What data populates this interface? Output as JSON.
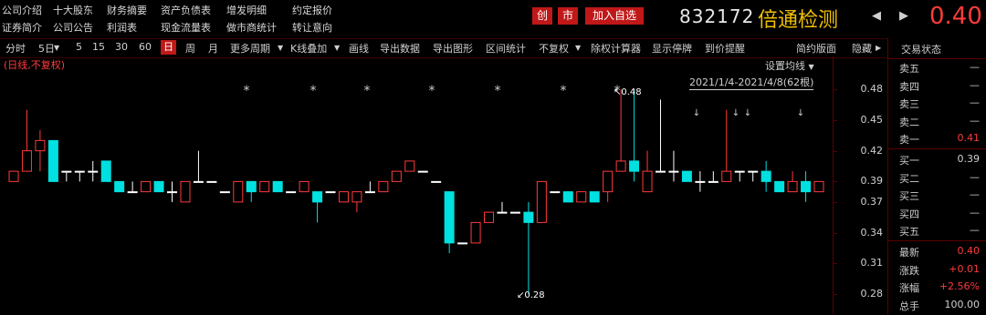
{
  "topbar": {
    "links_row1": [
      "公司介绍",
      "十大股东",
      "财务摘要",
      "资产负债表",
      "增发明细",
      "约定报价"
    ],
    "links_row2": [
      "证券简介",
      "公司公告",
      "利润表",
      "现金流量表",
      "做市商统计",
      "转让意向"
    ],
    "badge_chuang": "创",
    "badge_shi": "市",
    "add_favorite": "加入自选",
    "stock_code": "832172",
    "stock_name": "倍通检测",
    "price": "0.40",
    "prev_arrow": "◀",
    "next_arrow": "▶"
  },
  "toolbar": {
    "items": [
      "分时",
      "5日",
      "5",
      "15",
      "30",
      "60",
      "日",
      "周",
      "月",
      "更多周期",
      "K线叠加",
      "画线",
      "导出数据",
      "导出图形",
      "区间统计",
      "不复权",
      "除权计算器",
      "显示停牌",
      "到价提醒",
      "简约版面",
      "隐藏"
    ],
    "active": "日"
  },
  "chart_caption": "(日线,不复权)",
  "ma_setting": "设置均线",
  "range_label": "2021/1/4-2021/4/8(62根)",
  "high_label": "0.48",
  "low_label": "0.28",
  "star_marker": "*",
  "down_marker": "↓",
  "y_ticks": [
    "0.48",
    "0.45",
    "0.42",
    "0.39",
    "0.37",
    "0.34",
    "0.31",
    "0.28"
  ],
  "colors": {
    "up": "#ff3b3b",
    "down": "#00e0e0",
    "flat": "#ffffff",
    "accent": "#c01818",
    "name": "#f0c000"
  },
  "chart_data": {
    "type": "candlestick",
    "ylim": [
      0.265,
      0.505
    ],
    "candles": [
      {
        "o": 0.39,
        "h": 0.39,
        "l": 0.39,
        "c": 0.4
      },
      {
        "o": 0.4,
        "h": 0.46,
        "l": 0.4,
        "c": 0.42
      },
      {
        "o": 0.42,
        "h": 0.44,
        "l": 0.4,
        "c": 0.43
      },
      {
        "o": 0.43,
        "h": 0.43,
        "l": 0.39,
        "c": 0.39
      },
      {
        "o": 0.4,
        "h": 0.4,
        "l": 0.39,
        "c": 0.4
      },
      {
        "o": 0.4,
        "h": 0.4,
        "l": 0.39,
        "c": 0.4
      },
      {
        "o": 0.4,
        "h": 0.41,
        "l": 0.39,
        "c": 0.4
      },
      {
        "o": 0.41,
        "h": 0.41,
        "l": 0.39,
        "c": 0.39
      },
      {
        "o": 0.39,
        "h": 0.39,
        "l": 0.38,
        "c": 0.38
      },
      {
        "o": 0.38,
        "h": 0.39,
        "l": 0.38,
        "c": 0.38
      },
      {
        "o": 0.38,
        "h": 0.39,
        "l": 0.38,
        "c": 0.39
      },
      {
        "o": 0.39,
        "h": 0.39,
        "l": 0.38,
        "c": 0.38
      },
      {
        "o": 0.38,
        "h": 0.39,
        "l": 0.37,
        "c": 0.38
      },
      {
        "o": 0.37,
        "h": 0.39,
        "l": 0.37,
        "c": 0.39
      },
      {
        "o": 0.39,
        "h": 0.42,
        "l": 0.39,
        "c": 0.39
      },
      {
        "o": 0.39,
        "h": 0.39,
        "l": 0.39,
        "c": 0.39
      },
      {
        "o": 0.38,
        "h": 0.38,
        "l": 0.38,
        "c": 0.38
      },
      {
        "o": 0.37,
        "h": 0.39,
        "l": 0.37,
        "c": 0.39
      },
      {
        "o": 0.39,
        "h": 0.39,
        "l": 0.37,
        "c": 0.38
      },
      {
        "o": 0.38,
        "h": 0.39,
        "l": 0.38,
        "c": 0.39
      },
      {
        "o": 0.39,
        "h": 0.39,
        "l": 0.38,
        "c": 0.38
      },
      {
        "o": 0.38,
        "h": 0.38,
        "l": 0.38,
        "c": 0.38
      },
      {
        "o": 0.38,
        "h": 0.39,
        "l": 0.38,
        "c": 0.39
      },
      {
        "o": 0.38,
        "h": 0.38,
        "l": 0.35,
        "c": 0.37
      },
      {
        "o": 0.38,
        "h": 0.38,
        "l": 0.38,
        "c": 0.38
      },
      {
        "o": 0.37,
        "h": 0.38,
        "l": 0.37,
        "c": 0.38
      },
      {
        "o": 0.37,
        "h": 0.38,
        "l": 0.36,
        "c": 0.38
      },
      {
        "o": 0.38,
        "h": 0.39,
        "l": 0.38,
        "c": 0.38
      },
      {
        "o": 0.38,
        "h": 0.39,
        "l": 0.38,
        "c": 0.39
      },
      {
        "o": 0.39,
        "h": 0.4,
        "l": 0.39,
        "c": 0.4
      },
      {
        "o": 0.4,
        "h": 0.41,
        "l": 0.4,
        "c": 0.41
      },
      {
        "o": 0.4,
        "h": 0.4,
        "l": 0.4,
        "c": 0.4
      },
      {
        "o": 0.39,
        "h": 0.39,
        "l": 0.39,
        "c": 0.39
      },
      {
        "o": 0.38,
        "h": 0.38,
        "l": 0.32,
        "c": 0.33
      },
      {
        "o": 0.33,
        "h": 0.33,
        "l": 0.33,
        "c": 0.33
      },
      {
        "o": 0.33,
        "h": 0.35,
        "l": 0.33,
        "c": 0.35
      },
      {
        "o": 0.35,
        "h": 0.36,
        "l": 0.35,
        "c": 0.36
      },
      {
        "o": 0.36,
        "h": 0.37,
        "l": 0.36,
        "c": 0.36
      },
      {
        "o": 0.36,
        "h": 0.36,
        "l": 0.36,
        "c": 0.36
      },
      {
        "o": 0.36,
        "h": 0.37,
        "l": 0.28,
        "c": 0.35
      },
      {
        "o": 0.35,
        "h": 0.39,
        "l": 0.35,
        "c": 0.39
      },
      {
        "o": 0.38,
        "h": 0.38,
        "l": 0.38,
        "c": 0.38
      },
      {
        "o": 0.38,
        "h": 0.38,
        "l": 0.37,
        "c": 0.37
      },
      {
        "o": 0.37,
        "h": 0.38,
        "l": 0.37,
        "c": 0.38
      },
      {
        "o": 0.38,
        "h": 0.38,
        "l": 0.37,
        "c": 0.37
      },
      {
        "o": 0.38,
        "h": 0.4,
        "l": 0.37,
        "c": 0.4
      },
      {
        "o": 0.4,
        "h": 0.48,
        "l": 0.4,
        "c": 0.41
      },
      {
        "o": 0.41,
        "h": 0.48,
        "l": 0.39,
        "c": 0.4
      },
      {
        "o": 0.38,
        "h": 0.42,
        "l": 0.38,
        "c": 0.4
      },
      {
        "o": 0.4,
        "h": 0.47,
        "l": 0.4,
        "c": 0.4
      },
      {
        "o": 0.4,
        "h": 0.42,
        "l": 0.39,
        "c": 0.4
      },
      {
        "o": 0.4,
        "h": 0.4,
        "l": 0.39,
        "c": 0.39
      },
      {
        "o": 0.39,
        "h": 0.4,
        "l": 0.38,
        "c": 0.39
      },
      {
        "o": 0.39,
        "h": 0.4,
        "l": 0.39,
        "c": 0.39
      },
      {
        "o": 0.39,
        "h": 0.46,
        "l": 0.39,
        "c": 0.4
      },
      {
        "o": 0.4,
        "h": 0.4,
        "l": 0.39,
        "c": 0.4
      },
      {
        "o": 0.4,
        "h": 0.4,
        "l": 0.39,
        "c": 0.4
      },
      {
        "o": 0.4,
        "h": 0.41,
        "l": 0.38,
        "c": 0.39
      },
      {
        "o": 0.39,
        "h": 0.39,
        "l": 0.38,
        "c": 0.38
      },
      {
        "o": 0.38,
        "h": 0.4,
        "l": 0.38,
        "c": 0.39
      },
      {
        "o": 0.39,
        "h": 0.4,
        "l": 0.37,
        "c": 0.38
      },
      {
        "o": 0.38,
        "h": 0.39,
        "l": 0.38,
        "c": 0.39
      }
    ]
  },
  "panel": {
    "title": "交易状态",
    "sells": [
      {
        "label": "卖五",
        "value": "—"
      },
      {
        "label": "卖四",
        "value": "—"
      },
      {
        "label": "卖三",
        "value": "—"
      },
      {
        "label": "卖二",
        "value": "—"
      },
      {
        "label": "卖一",
        "value": "0.41"
      }
    ],
    "buys": [
      {
        "label": "买一",
        "value": "0.39"
      },
      {
        "label": "买二",
        "value": "—"
      },
      {
        "label": "买三",
        "value": "—"
      },
      {
        "label": "买四",
        "value": "—"
      },
      {
        "label": "买五",
        "value": "—"
      }
    ],
    "stats": [
      {
        "label": "最新",
        "value": "0.40"
      },
      {
        "label": "涨跌",
        "value": "+0.01"
      },
      {
        "label": "涨幅",
        "value": "+2.56%"
      },
      {
        "label": "总手",
        "value": "100.00"
      }
    ]
  }
}
